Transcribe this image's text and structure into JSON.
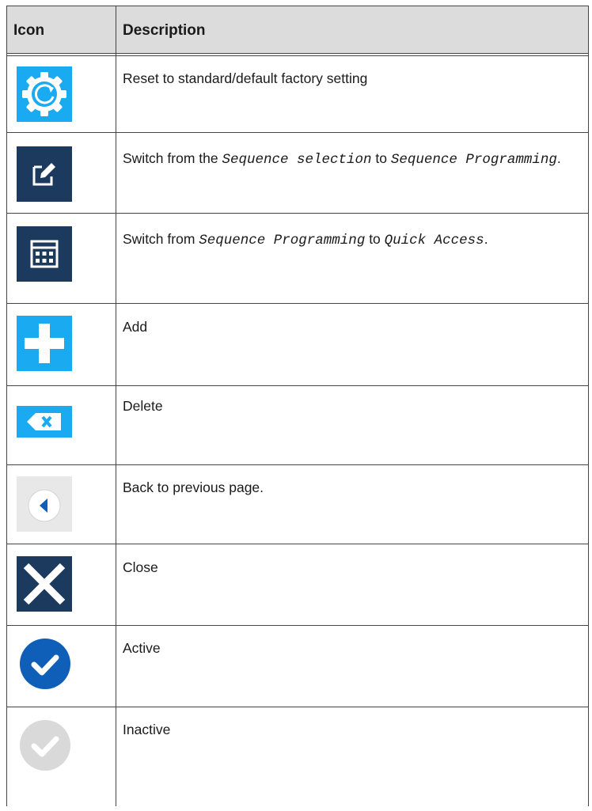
{
  "header": {
    "icon_col": "Icon",
    "desc_col": "Description"
  },
  "rows": [
    {
      "icon": "reset-settings-icon",
      "icon_color": "#1aaaf2",
      "parts": [
        {
          "text": "Reset to standard/default factory setting",
          "mono": false
        }
      ]
    },
    {
      "icon": "edit-icon",
      "icon_color": "#1c3a5e",
      "parts": [
        {
          "text": "Switch from the ",
          "mono": false
        },
        {
          "text": "Sequence selection",
          "mono": true
        },
        {
          "text": " to ",
          "mono": false
        },
        {
          "text": "Sequence Programming",
          "mono": true
        },
        {
          "text": ".",
          "mono": false
        }
      ]
    },
    {
      "icon": "calculator-icon",
      "icon_color": "#1c3a5e",
      "parts": [
        {
          "text": "Switch from ",
          "mono": false
        },
        {
          "text": "Sequence Programming",
          "mono": true
        },
        {
          "text": " to ",
          "mono": false
        },
        {
          "text": "Quick Access",
          "mono": true
        },
        {
          "text": ".",
          "mono": false
        }
      ]
    },
    {
      "icon": "add-icon",
      "icon_color": "#1aaaf2",
      "parts": [
        {
          "text": "Add",
          "mono": false
        }
      ]
    },
    {
      "icon": "delete-icon",
      "icon_color": "#1aaaf2",
      "parts": [
        {
          "text": "Delete",
          "mono": false
        }
      ]
    },
    {
      "icon": "back-icon",
      "icon_color": "#0f5fb8",
      "parts": [
        {
          "text": "Back to previous page.",
          "mono": false
        }
      ]
    },
    {
      "icon": "close-icon",
      "icon_color": "#1c3a5e",
      "parts": [
        {
          "text": "Close",
          "mono": false
        }
      ]
    },
    {
      "icon": "active-check-icon",
      "icon_color": "#0f5fb8",
      "parts": [
        {
          "text": "Active",
          "mono": false
        }
      ]
    },
    {
      "icon": "inactive-check-icon",
      "icon_color": "#d9d9d9",
      "parts": [
        {
          "text": "Inactive",
          "mono": false
        }
      ]
    }
  ]
}
